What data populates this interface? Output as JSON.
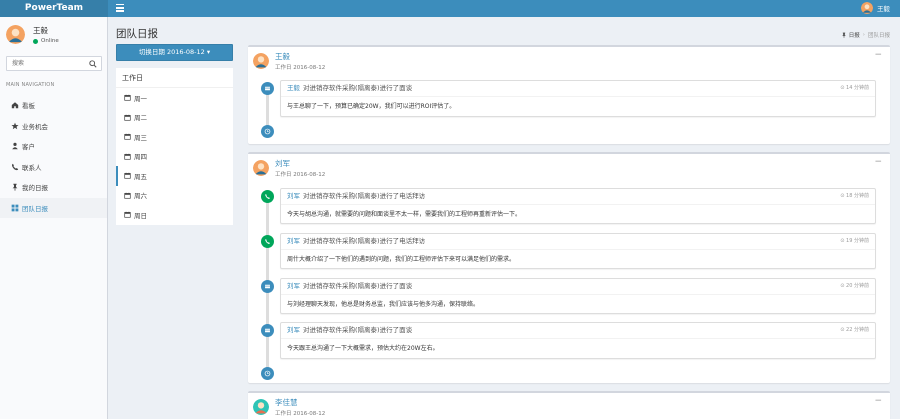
{
  "app": {
    "logo": "PowerTeam"
  },
  "navbar": {
    "user_name": "王毅"
  },
  "sidebar": {
    "user": {
      "name": "王毅",
      "status": "Online"
    },
    "search_placeholder": "搜索",
    "header": "MAIN NAVIGATION",
    "items": [
      {
        "label": "看板",
        "icon": "dashboard-icon"
      },
      {
        "label": "业务机会",
        "icon": "star-icon"
      },
      {
        "label": "客户",
        "icon": "customer-icon"
      },
      {
        "label": "联系人",
        "icon": "contact-icon"
      },
      {
        "label": "我的日报",
        "icon": "pin-icon"
      },
      {
        "label": "团队日报",
        "icon": "team-icon",
        "active": true
      }
    ]
  },
  "page": {
    "title": "团队日报",
    "breadcrumb": [
      "日报",
      "团队日报"
    ]
  },
  "week": {
    "date_button": "切换日期 2016-08-12 ▾",
    "header": "工作日",
    "days": [
      "周一",
      "周二",
      "周三",
      "周四",
      "周五",
      "周六",
      "周日"
    ],
    "active_index": 4
  },
  "reports": [
    {
      "author": "王毅",
      "date": "工作日 2016-08-12",
      "items": [
        {
          "type": "meeting",
          "who": "王毅",
          "action": "对进销存软件采购(隔离泰)进行了面谈",
          "time": "14 分钟前",
          "body": "与王总聊了一下，预算已确定20W，我们可以进行ROI评估了。"
        }
      ]
    },
    {
      "author": "刘军",
      "date": "工作日 2016-08-12",
      "items": [
        {
          "type": "phone",
          "who": "刘军",
          "action": "对进销存软件采购(隔离泰)进行了电话拜访",
          "time": "18 分钟前",
          "body": "今天与胡总沟通，就需要的问题和面谈里不太一样，需要我们的工程师再重新评估一下。"
        },
        {
          "type": "phone",
          "who": "刘军",
          "action": "对进销存软件采购(隔离泰)进行了电话拜访",
          "time": "19 分钟前",
          "body": "周什大概介绍了一下他们的遇到的问题，我们的工程师评估下来可以满足他们的需求。"
        },
        {
          "type": "meeting",
          "who": "刘军",
          "action": "对进销存软件采购(隔离泰)进行了面谈",
          "time": "20 分钟前",
          "body": "与刘经理聊天发现，他总是财务总监，我们应该与他多沟通，保持联络。"
        },
        {
          "type": "meeting",
          "who": "刘军",
          "action": "对进销存软件采购(隔离泰)进行了面谈",
          "time": "22 分钟前",
          "body": "今天跟王总沟通了一下大概需求，预估大约在20W左右。"
        }
      ]
    },
    {
      "author": "李佳慧",
      "date": "工作日 2016-08-12",
      "items": []
    }
  ],
  "colors": {
    "primary": "#3c8dbc",
    "logo_bg": "#367fa9",
    "green": "#00a65a"
  }
}
